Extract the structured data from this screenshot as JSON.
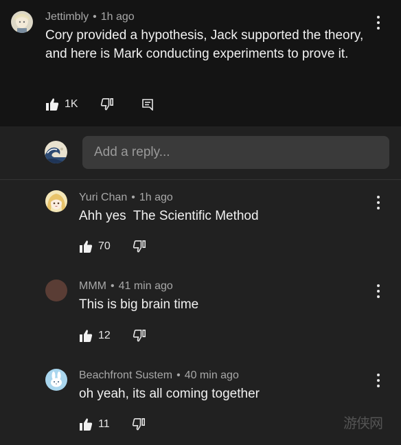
{
  "top_comment": {
    "author": "Jettimbly",
    "time": "1h ago",
    "text": "Cory provided a hypothesis, Jack supported the theory, and here is Mark conducting experiments to prove it.",
    "likes": "1K"
  },
  "reply_box": {
    "placeholder": "Add a reply..."
  },
  "replies": [
    {
      "author": "Yuri Chan",
      "time": "1h ago",
      "text": "Ahh yes  The Scientific Method",
      "likes": "70"
    },
    {
      "author": "MMM",
      "time": "41 min ago",
      "text": "This is big brain time",
      "likes": "12"
    },
    {
      "author": "Beachfront Sustem",
      "time": "40 min ago",
      "text": "oh yeah, its all coming together",
      "likes": "11"
    }
  ],
  "separator": "•",
  "watermark": "游侠网",
  "colors": {
    "background": "#212121",
    "top_comment_bg": "#141414",
    "reply_box_bg": "#3a3a3a",
    "meta_text": "#a8a8a8"
  }
}
